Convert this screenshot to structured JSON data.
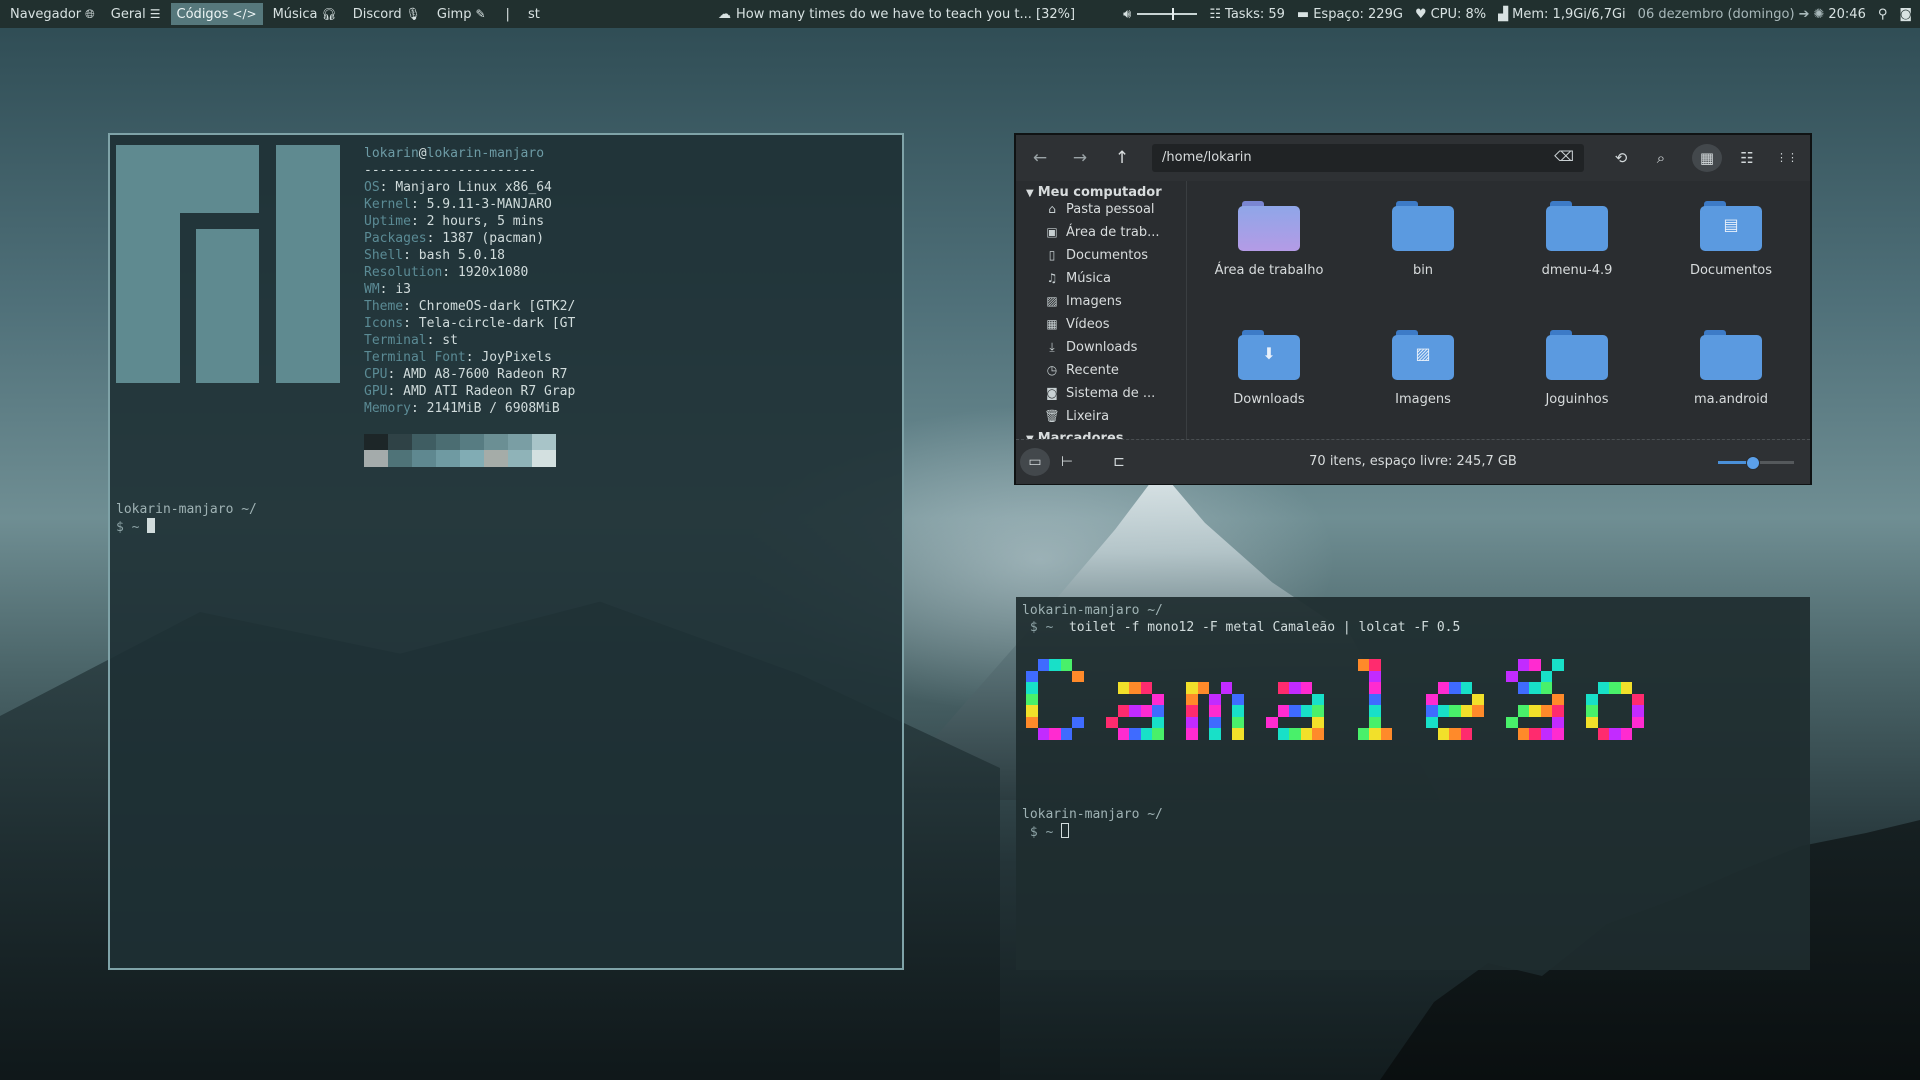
{
  "topbar": {
    "workspaces": [
      {
        "label": "Navegador",
        "glyph": "🌐︎"
      },
      {
        "label": "Geral",
        "glyph": "☰"
      },
      {
        "label": "Códigos",
        "glyph": "</>"
      },
      {
        "label": "Música",
        "glyph": "🎧︎"
      },
      {
        "label": "Discord",
        "glyph": "🎙︎"
      },
      {
        "label": "Gimp",
        "glyph": "✎"
      }
    ],
    "separator": "|",
    "active_window": "st",
    "focused_title": "How many times do we have to teach you t... [32%]",
    "tasks": "Tasks: 59",
    "space": "Espaço: 229G",
    "cpu": "CPU:  8%",
    "mem": "Mem: 1,9Gi/6,7Gi",
    "date": "06 dezembro (domingo)",
    "time": "20:46",
    "volume_level": 0.58
  },
  "terminal1": {
    "user": "lokarin",
    "at": "@",
    "host": "lokarin-manjaro",
    "rule": "----------------------",
    "info": [
      {
        "key": "OS",
        "value": "Manjaro Linux x86_64"
      },
      {
        "key": "Kernel",
        "value": "5.9.11-3-MANJARO"
      },
      {
        "key": "Uptime",
        "value": "2 hours, 5 mins"
      },
      {
        "key": "Packages",
        "value": "1387 (pacman)"
      },
      {
        "key": "Shell",
        "value": "bash 5.0.18"
      },
      {
        "key": "Resolution",
        "value": "1920x1080"
      },
      {
        "key": "WM",
        "value": "i3"
      },
      {
        "key": "Theme",
        "value": "ChromeOS-dark [GTK2/"
      },
      {
        "key": "Icons",
        "value": "Tela-circle-dark [GT"
      },
      {
        "key": "Terminal",
        "value": "st"
      },
      {
        "key": "Terminal Font",
        "value": "JoyPixels"
      },
      {
        "key": "CPU",
        "value": "AMD A8-7600 Radeon R7"
      },
      {
        "key": "GPU",
        "value": "AMD ATI Radeon R7 Grap"
      },
      {
        "key": "Memory",
        "value": "2141MiB / 6908MiB"
      }
    ],
    "palette": [
      "#1d2628",
      "#2f4246",
      "#3f5d62",
      "#4b6d72",
      "#577c82",
      "#6b8f94",
      "#7a9ea4",
      "#a8c4c8",
      "#a4abab",
      "#4f7378",
      "#5f8890",
      "#6f9aa2",
      "#81acb4",
      "#a5aca8",
      "#8fb3b8",
      "#d3e0e0"
    ],
    "prompt_host": "lokarin-manjaro ~/",
    "prompt_symbol": " $ ~"
  },
  "filemanager": {
    "path": "/home/lokarin",
    "sidebar_header": "Meu computador",
    "sidebar_items": [
      {
        "label": "Pasta pessoal",
        "icon": "home-icon",
        "glyph": "⌂"
      },
      {
        "label": "Área de trab...",
        "icon": "desktop-icon",
        "glyph": "▣"
      },
      {
        "label": "Documentos",
        "icon": "document-icon",
        "glyph": "▯"
      },
      {
        "label": "Música",
        "icon": "music-icon",
        "glyph": "♫"
      },
      {
        "label": "Imagens",
        "icon": "image-icon",
        "glyph": "▨"
      },
      {
        "label": "Vídeos",
        "icon": "video-icon",
        "glyph": "▦"
      },
      {
        "label": "Downloads",
        "icon": "download-icon",
        "glyph": "⤓"
      },
      {
        "label": "Recente",
        "icon": "recent-icon",
        "glyph": "◷"
      },
      {
        "label": "Sistema de ...",
        "icon": "drive-icon",
        "glyph": "◙"
      },
      {
        "label": "Lixeira",
        "icon": "trash-icon",
        "glyph": "🗑︎"
      }
    ],
    "sidebar_header2": "Marcadores",
    "files": [
      {
        "name": "Área de trabalho",
        "emblem": "",
        "pink": true
      },
      {
        "name": "bin",
        "emblem": "",
        "pink": false
      },
      {
        "name": "dmenu-4.9",
        "emblem": "",
        "pink": false
      },
      {
        "name": "Documentos",
        "emblem": "▤",
        "pink": false
      },
      {
        "name": "Downloads",
        "emblem": "⬇",
        "pink": false
      },
      {
        "name": "Imagens",
        "emblem": "▨",
        "pink": false
      },
      {
        "name": "Joguinhos",
        "emblem": "",
        "pink": false
      },
      {
        "name": "ma.android",
        "emblem": "",
        "pink": false
      }
    ],
    "status": "70 itens, espaço livre: 245,7 GB",
    "zoom_level": 0.45,
    "glyphs": {
      "back": "←",
      "forward": "→",
      "up": "↑",
      "clear": "⌫",
      "reload": "⟲",
      "search": "⌕",
      "grid": "▦",
      "list": "☷",
      "compact": "⋮⋮",
      "places": "▭",
      "tree": "⊢",
      "sidebar_toggle": "⊏"
    }
  },
  "terminal2": {
    "prompt_host": "lokarin-manjaro ~/",
    "prompt_symbol": " $ ~",
    "command": "toilet -f mono12 -F metal Camaleão | lolcat -F 0.5",
    "banner_text": "Camaleão",
    "banner_colors": [
      "#ff2bd0",
      "#3f6bff",
      "#18e0c8",
      "#49f06a",
      "#f2e02a",
      "#ff8a2a",
      "#ff2b6e",
      "#c22bff"
    ]
  },
  "colors": {
    "accent": "#56787c",
    "term_key": "#5b8b95",
    "fm_bg": "#2a2d30",
    "folder_blue": "#5b9ae0"
  }
}
